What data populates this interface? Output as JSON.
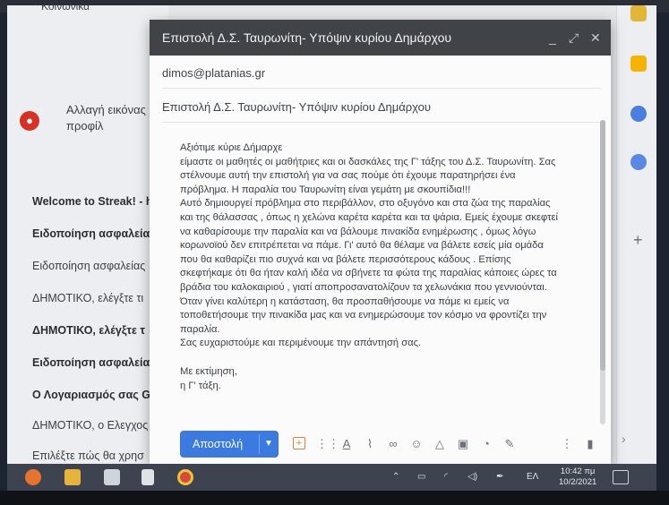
{
  "inbox": {
    "top_partial": "Κοινωνικά",
    "profile_change": "Αλλαγή εικόνας προφίλ",
    "rows": [
      {
        "text": "Welcome to Streak! - h",
        "bold": true
      },
      {
        "text": "Ειδοποίηση ασφαλείας",
        "bold": true
      },
      {
        "text": "Ειδοποίηση ασφαλείας",
        "bold": false
      },
      {
        "text": "ΔΗΜΟΤΙΚΟ, ελέγξτε τι",
        "bold": false
      },
      {
        "text": "ΔΗΜΟΤΙΚΟ, ελέγξτε τ",
        "bold": true
      },
      {
        "text": "Ειδοποίηση ασφαλείας",
        "bold": true
      },
      {
        "text": "Ο Λογαριασμός σας Go",
        "bold": true
      },
      {
        "text": "ΔΗΜΟΤΙΚΟ, ο Ελεγχος",
        "bold": false
      },
      {
        "text": "Επιλέξτε πώς θα χρησ",
        "bold": false
      }
    ]
  },
  "compose": {
    "title": "Επιστολή Δ.Σ. Ταυρωνίτη- Υπόψιν κυρίου Δημάρχου",
    "to": "dimos@platanias.gr",
    "subject": "Επιστολή Δ.Σ. Ταυρωνίτη- Υπόψιν κυρίου Δημάρχου",
    "body_lines": [
      "Αξιότιμε κύριε Δήμαρχε",
      "είμαστε οι μαθητές  οι μαθήτριες και οι δασκάλες της Γ' τάξης του Δ.Σ. Ταυρωνίτη. Σας",
      "στέλνουμε  αυτή την επιστολή για να σας πούμε  ότι έχουμε  παρατηρήσει  ένα",
      "πρόβλημα.  Η παραλία του Ταυρωνίτη είναι γεμάτη με σκουπίδια!!!",
      "   Αυτό δημιουργεί πρόβλημα στο περιβάλλον, στο οξυγόνο και στα ζώα της παραλίας",
      "και της θάλασσας , όπως η χελώνα καρέτα καρέτα και τα ψάρια. Εμείς έχουμε σκεφτεί",
      "να καθαρίσουμε την παραλία και  να βάλουμε πινακίδα ενημέρωσης , όμως λόγω",
      "κορωνοϊού δεν επιτρέπεται να πάμε. Γι' αυτό θα θέλαμε να βάλετε εσείς μία ομάδα",
      "που θα καθαρίζει πιο συχνά και να βάλετε περισσότερους κάδους . Επίσης",
      " σκεφτήκαμε ότι θα ήταν καλή  ιδέα να σβήνετε τα φώτα της παραλίας κάποιες ώρες τα",
      "βράδια του καλοκαιριού , γιατί αποπροσανατολίζουν τα χελωνάκια που γεννιούνται.",
      "  Όταν γίνει καλύτερη η κατάσταση, θα προσπαθήσουμε να πάμε κι εμείς να",
      "τοποθετήσουμε την πινακίδα μας και να ενημερώσουμε τον κόσμο να φροντίζει την",
      "παραλία.",
      "Σας ευχαριστούμε και περιμένουμε την απάντησή σας."
    ],
    "signature_lines": [
      "Με εκτίμηση,",
      "η Γ' τάξη."
    ],
    "send_label": "Αποστολή"
  },
  "taskbar": {
    "language": "ΕΛ",
    "time": "10:42 πμ",
    "date": "10/2/2021"
  },
  "colors": {
    "accent": "#3b7ae0",
    "compose_header": "#404448",
    "taskbar": "#3d4450",
    "error": "#d93025"
  }
}
